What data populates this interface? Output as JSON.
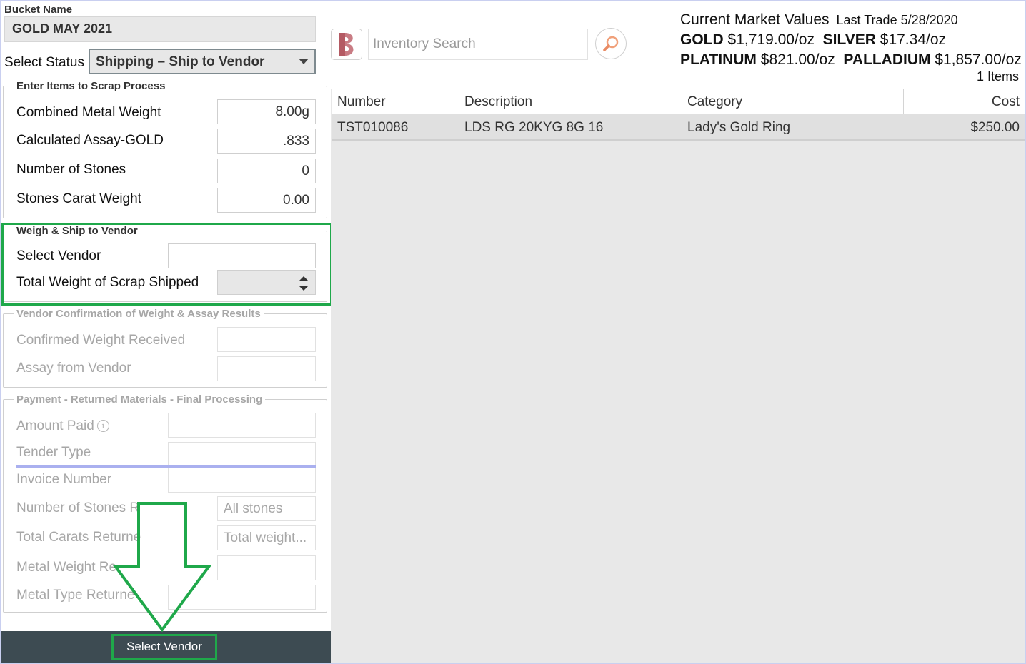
{
  "bucket": {
    "label": "Bucket Name",
    "value": "GOLD MAY 2021"
  },
  "status": {
    "label": "Select Status",
    "value": "Shipping – Ship to Vendor"
  },
  "scrap_process": {
    "legend": "Enter Items to Scrap Process",
    "rows": [
      {
        "label": "Combined Metal Weight",
        "value": "8.00g"
      },
      {
        "label": "Calculated Assay-GOLD",
        "value": ".833"
      },
      {
        "label": "Number of Stones",
        "value": "0"
      },
      {
        "label": "Stones Carat Weight",
        "value": "0.00"
      }
    ]
  },
  "weigh_ship": {
    "legend": "Weigh & Ship to Vendor",
    "vendor_label": "Select Vendor",
    "vendor_value": "",
    "weight_label": "Total Weight of Scrap Shipped",
    "weight_value": ""
  },
  "vendor_confirmation": {
    "legend": "Vendor Confirmation of Weight & Assay Results",
    "rows": [
      {
        "label": "Confirmed Weight Received",
        "value": ""
      },
      {
        "label": "Assay from Vendor",
        "value": ""
      }
    ]
  },
  "payment": {
    "legend": "Payment - Returned Materials - Final Processing",
    "amount_paid": "Amount Paid",
    "tender_type": "Tender Type",
    "invoice_number": "Invoice Number",
    "stones_returned": "Number of Stones R",
    "stones_placeholder": "All stones",
    "carats_returned": "Total Carats Returne",
    "carats_placeholder": "Total weight...",
    "metal_weight_returned": "Metal Weight Re",
    "metal_type_returned": "Metal Type Returne"
  },
  "bottom_button": "Select Vendor",
  "search": {
    "placeholder": "Inventory Search"
  },
  "market": {
    "title": "Current Market Values",
    "last_trade": "Last Trade 5/28/2020",
    "gold_label": "GOLD",
    "gold_value": "$1,719.00/oz",
    "silver_label": "SILVER",
    "silver_value": "$17.34/oz",
    "platinum_label": "PLATINUM",
    "platinum_value": "$821.00/oz",
    "palladium_label": "PALLADIUM",
    "palladium_value": "$1,857.00/oz",
    "items_count": "1 Items"
  },
  "table": {
    "headers": [
      "Number",
      "Description",
      "Category",
      "Cost"
    ],
    "rows": [
      [
        "TST010086",
        "LDS RG 20KYG 8G 16",
        "Lady's Gold Ring",
        "$250.00"
      ]
    ]
  },
  "colors": {
    "highlight": "#1fa84a",
    "bottom_bar": "#3d4b52"
  }
}
